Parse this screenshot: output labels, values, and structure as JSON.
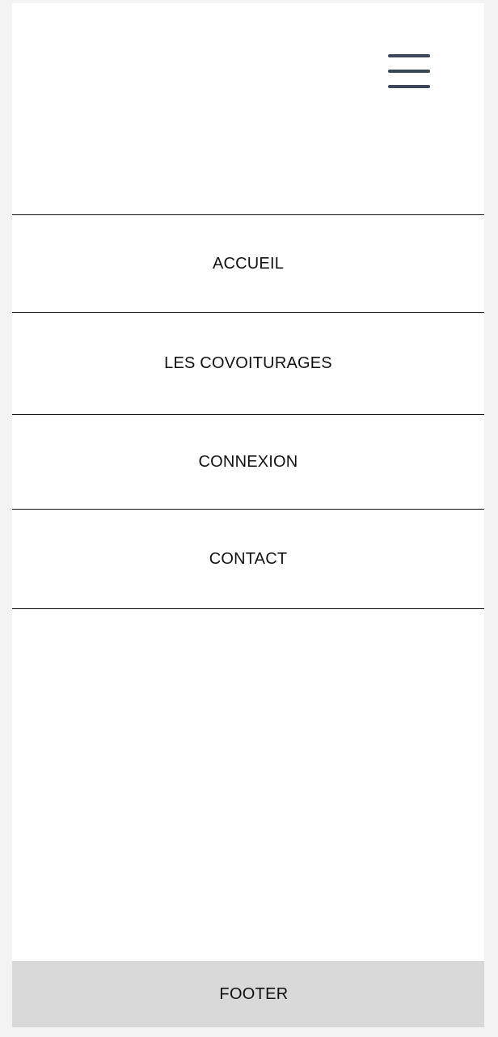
{
  "header": {
    "menu_icon": "hamburger-menu-icon",
    "menu_icon_color": "#3b4656"
  },
  "nav": {
    "items": [
      {
        "label": "ACCUEIL"
      },
      {
        "label": "LES COVOITURAGES"
      },
      {
        "label": "CONNEXION"
      },
      {
        "label": "CONTACT"
      }
    ]
  },
  "footer": {
    "label": "FOOTER",
    "background": "#d9d9d9"
  }
}
